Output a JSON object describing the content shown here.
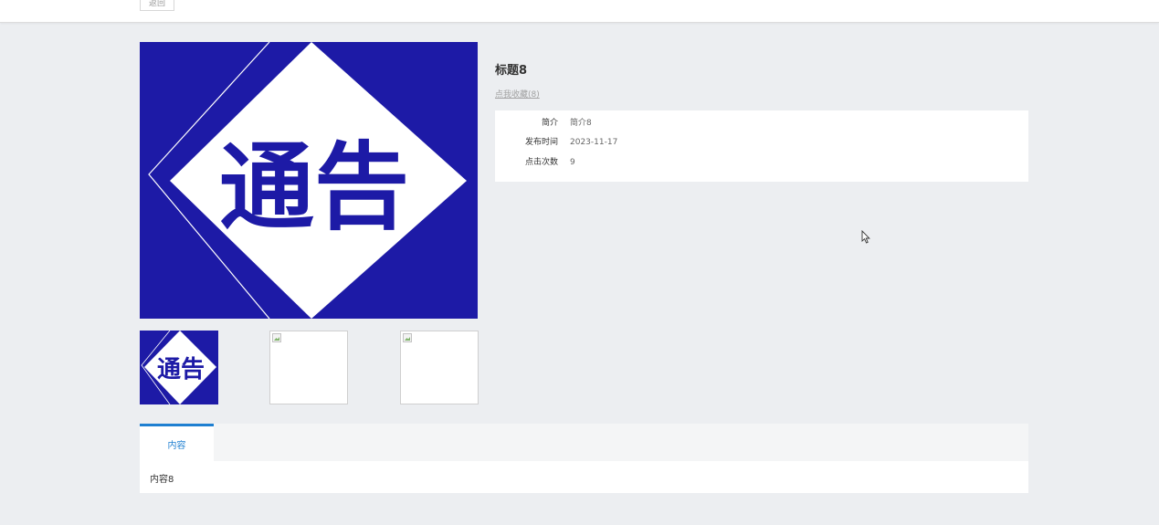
{
  "header": {
    "back_label": "返回"
  },
  "notice_image": {
    "text": "通告",
    "bg_color": "#1d1aa6"
  },
  "item": {
    "title": "标题8",
    "favorite_link": "点我收藏(8)",
    "details": [
      {
        "label": "简介",
        "value": "简介8"
      },
      {
        "label": "发布时间",
        "value": "2023-11-17"
      },
      {
        "label": "点击次数",
        "value": "9"
      }
    ]
  },
  "tabs": [
    {
      "label": "内容"
    }
  ],
  "content": {
    "text": "内容8"
  },
  "accent_color": "#1e7fd1"
}
